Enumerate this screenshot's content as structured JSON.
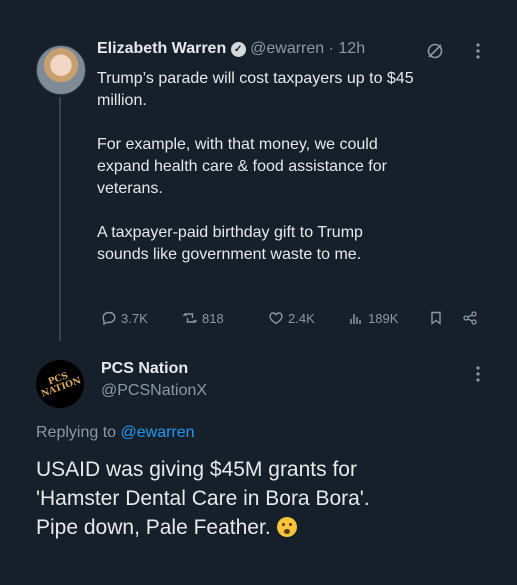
{
  "tweet": {
    "author": "Elizabeth Warren",
    "handle": "@ewarren",
    "separator": "·",
    "time": "12h",
    "lines": [
      "Trump’s parade will cost taxpayers up to $45",
      "million.",
      "For example, with that money, we could",
      "expand health care & food assistance for",
      "veterans.",
      "A taxpayer-paid birthday gift to Trump",
      "sounds like government waste to me."
    ],
    "stats": {
      "replies": "3.7K",
      "reposts": "818",
      "likes": "2.4K",
      "views": "189K"
    }
  },
  "reply": {
    "author": "PCS Nation",
    "handle": "@PCSNationX",
    "avatar_text_1": "PCS",
    "avatar_text_2": "NATION",
    "replying_prefix": "Replying to",
    "replying_to": "@ewarren",
    "lines": [
      "USAID was giving $45M grants for",
      "'Hamster Dental Care in Bora Bora'.",
      "Pipe down, Pale Feather."
    ]
  },
  "colors": {
    "background": "#15202b",
    "text": "#e7e9ea",
    "muted": "#8b98a5",
    "link": "#1d9bf0"
  }
}
